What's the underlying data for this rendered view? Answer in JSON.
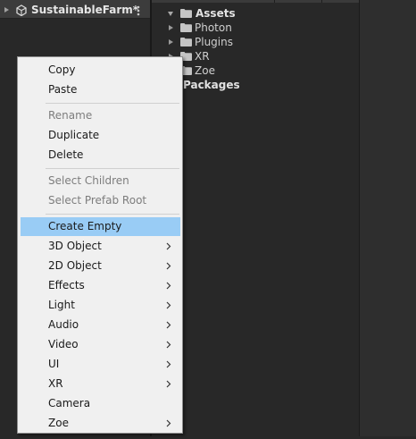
{
  "hierarchy": {
    "scene_name": "SustainableFarm*",
    "icons": {
      "fold": "triangle-right-icon",
      "scene": "unity-scene-icon",
      "menu": "kebab-menu-icon"
    }
  },
  "project": {
    "tree": [
      {
        "id": "assets",
        "label": "Assets",
        "expanded": true,
        "icon": "folder-icon"
      },
      {
        "id": "photon",
        "label": "Photon",
        "expanded": false,
        "icon": "folder-icon"
      },
      {
        "id": "plugins",
        "label": "Plugins",
        "expanded": false,
        "icon": "folder-icon"
      },
      {
        "id": "xr",
        "label": "XR",
        "expanded": false,
        "icon": "folder-icon"
      },
      {
        "id": "zoe",
        "label": "Zoe",
        "expanded": false,
        "icon": "folder-icon"
      },
      {
        "id": "packages",
        "label": "Packages",
        "expanded": false,
        "icon": ""
      }
    ]
  },
  "context_menu": {
    "items": [
      {
        "label": "Copy",
        "enabled": true,
        "submenu": false
      },
      {
        "label": "Paste",
        "enabled": true,
        "submenu": false
      },
      {
        "label": "Rename",
        "enabled": false,
        "submenu": false
      },
      {
        "label": "Duplicate",
        "enabled": true,
        "submenu": false
      },
      {
        "label": "Delete",
        "enabled": true,
        "submenu": false
      },
      {
        "label": "Select Children",
        "enabled": false,
        "submenu": false
      },
      {
        "label": "Select Prefab Root",
        "enabled": false,
        "submenu": false
      },
      {
        "label": "Create Empty",
        "enabled": true,
        "submenu": false,
        "highlighted": true
      },
      {
        "label": "3D Object",
        "enabled": true,
        "submenu": true
      },
      {
        "label": "2D Object",
        "enabled": true,
        "submenu": true
      },
      {
        "label": "Effects",
        "enabled": true,
        "submenu": true
      },
      {
        "label": "Light",
        "enabled": true,
        "submenu": true
      },
      {
        "label": "Audio",
        "enabled": true,
        "submenu": true
      },
      {
        "label": "Video",
        "enabled": true,
        "submenu": true
      },
      {
        "label": "UI",
        "enabled": true,
        "submenu": true
      },
      {
        "label": "XR",
        "enabled": true,
        "submenu": true
      },
      {
        "label": "Camera",
        "enabled": true,
        "submenu": false
      },
      {
        "label": "Zoe",
        "enabled": true,
        "submenu": true
      }
    ],
    "colors": {
      "background": "#f0f0f0",
      "highlight": "#99ccf5",
      "disabled_text": "#7d7d7d"
    }
  }
}
